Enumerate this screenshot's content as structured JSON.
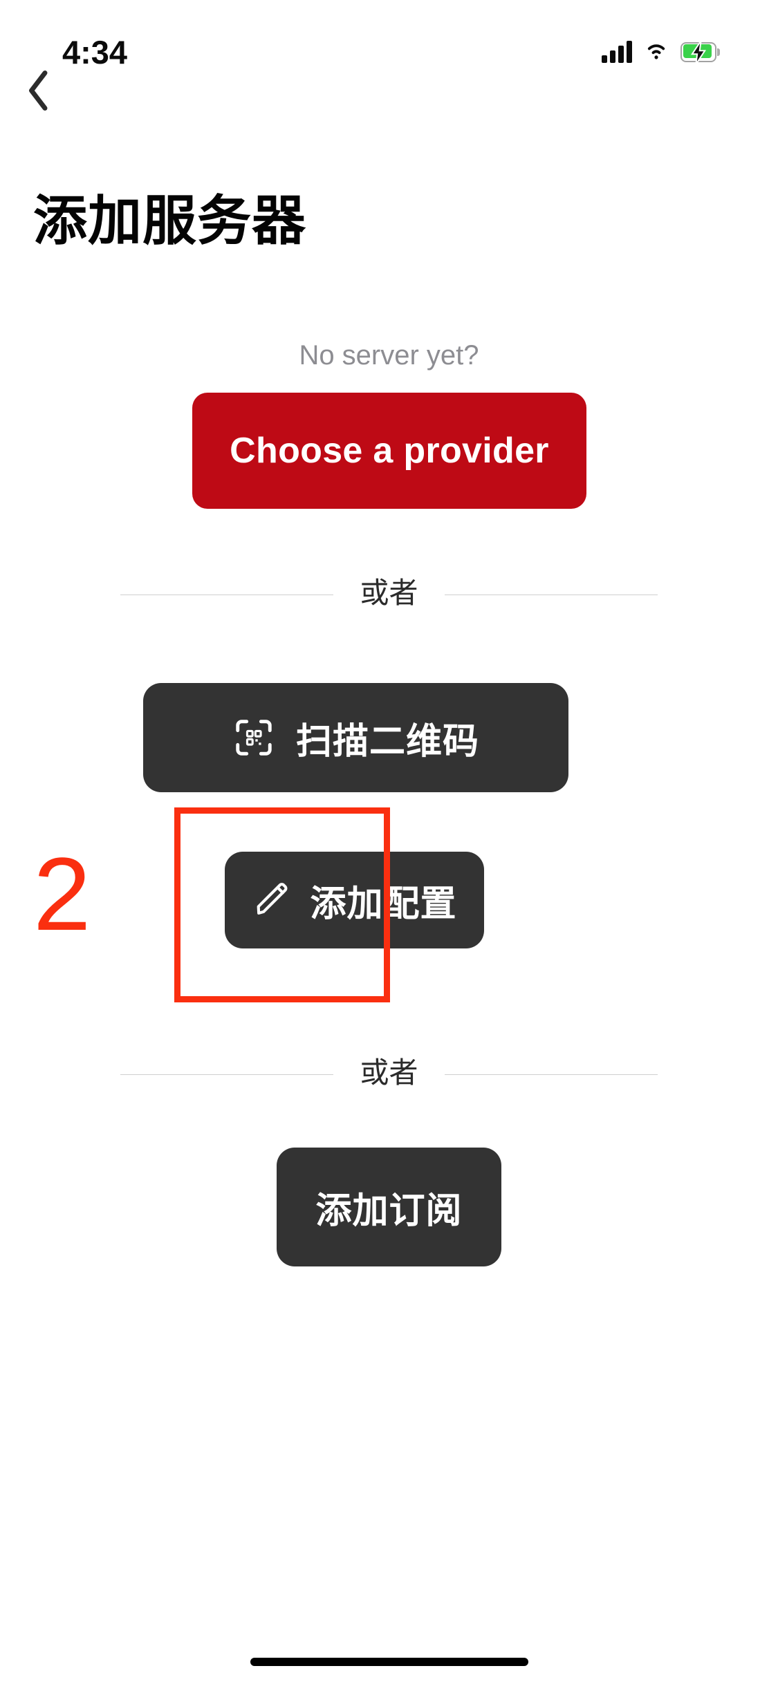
{
  "status_bar": {
    "time": "4:34",
    "signal_icon": "cellular-signal-icon",
    "wifi_icon": "wifi-icon",
    "battery_icon": "battery-charging-icon",
    "battery_color": "#3ad24a"
  },
  "header": {
    "back_icon": "back-chevron-icon",
    "title": "添加服务器"
  },
  "main": {
    "subtitle": "No server yet?",
    "provider_button": {
      "label": "Choose a provider",
      "color": "#be0a15",
      "text_color": "#ffffff"
    },
    "divider_1_label": "或者",
    "scan_qr_button": {
      "label": "扫描二维码",
      "icon": "qr-scan-icon",
      "color": "#333333"
    },
    "add_config_button": {
      "label": "添加配置",
      "icon": "pencil-icon",
      "color": "#333333"
    },
    "divider_2_label": "或者",
    "add_subscription_button": {
      "label": "添加订阅",
      "color": "#333333"
    }
  },
  "annotation": {
    "step_number": "2",
    "highlight_color": "#fa2f10"
  },
  "home_indicator": "home-indicator"
}
